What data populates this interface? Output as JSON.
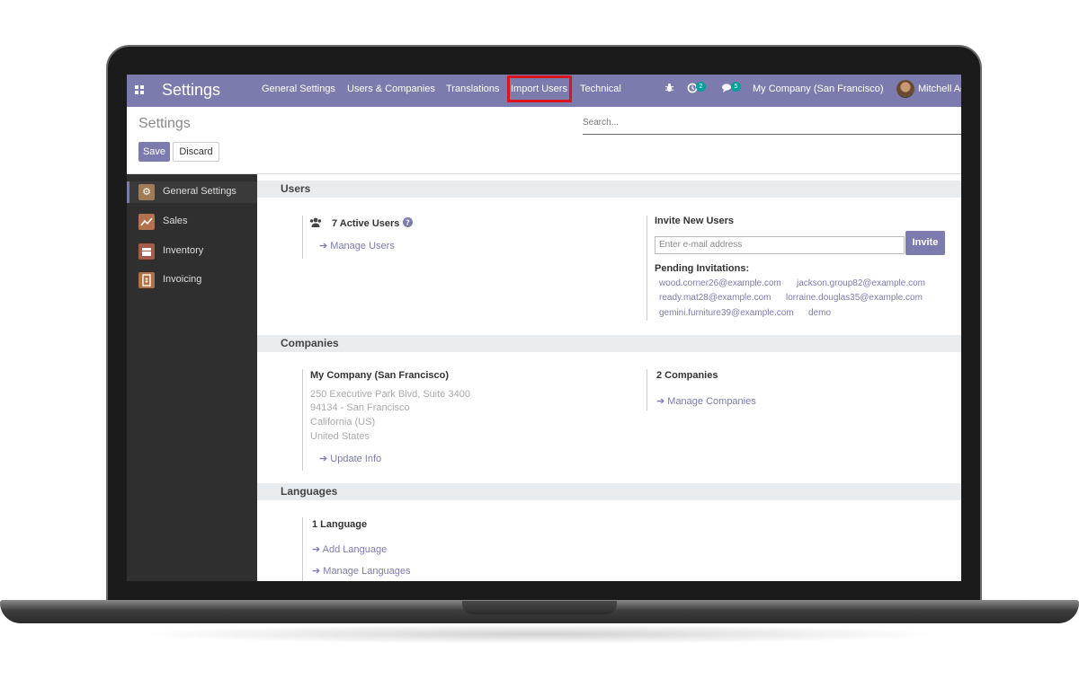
{
  "navbar": {
    "app_title": "Settings",
    "menu": [
      "General Settings",
      "Users & Companies",
      "Translations",
      "Import Users",
      "Technical"
    ],
    "activity_count": "2",
    "messages_count": "5",
    "company": "My Company (San Francisco)",
    "user": "Mitchell Ad",
    "accent": "#7c7bad",
    "highlight_color": "#d9141c"
  },
  "control_panel": {
    "title": "Settings",
    "search_placeholder": "Search...",
    "save_label": "Save",
    "discard_label": "Discard"
  },
  "sidebar": {
    "items": [
      {
        "label": "General Settings",
        "icon": "gear-icon",
        "color": "#a07c56"
      },
      {
        "label": "Sales",
        "icon": "chart-icon",
        "color": "#b5704d"
      },
      {
        "label": "Inventory",
        "icon": "box-icon",
        "color": "#a75a4a"
      },
      {
        "label": "Invoicing",
        "icon": "invoice-icon",
        "color": "#b07245"
      }
    ]
  },
  "users": {
    "heading": "Users",
    "active_users": "7 Active Users",
    "manage_users": "Manage Users",
    "invite_title": "Invite New Users",
    "invite_placeholder": "Enter e-mail address",
    "invite_button": "Invite",
    "pending_title": "Pending Invitations:",
    "pending": [
      "wood.corner26@example.com",
      "jackson.group82@example.com",
      "ready.mat28@example.com",
      "lorraine.douglas35@example.com",
      "gemini.furniture39@example.com",
      "demo"
    ]
  },
  "companies": {
    "heading": "Companies",
    "name": "My Company (San Francisco)",
    "address": [
      "250 Executive Park Blvd, Suite 3400",
      "94134 - San Francisco",
      "California (US)",
      "United States"
    ],
    "update_info": "Update Info",
    "count": "2 Companies",
    "manage": "Manage Companies"
  },
  "languages": {
    "heading": "Languages",
    "count": "1 Language",
    "add": "Add Language",
    "manage": "Manage Languages"
  }
}
